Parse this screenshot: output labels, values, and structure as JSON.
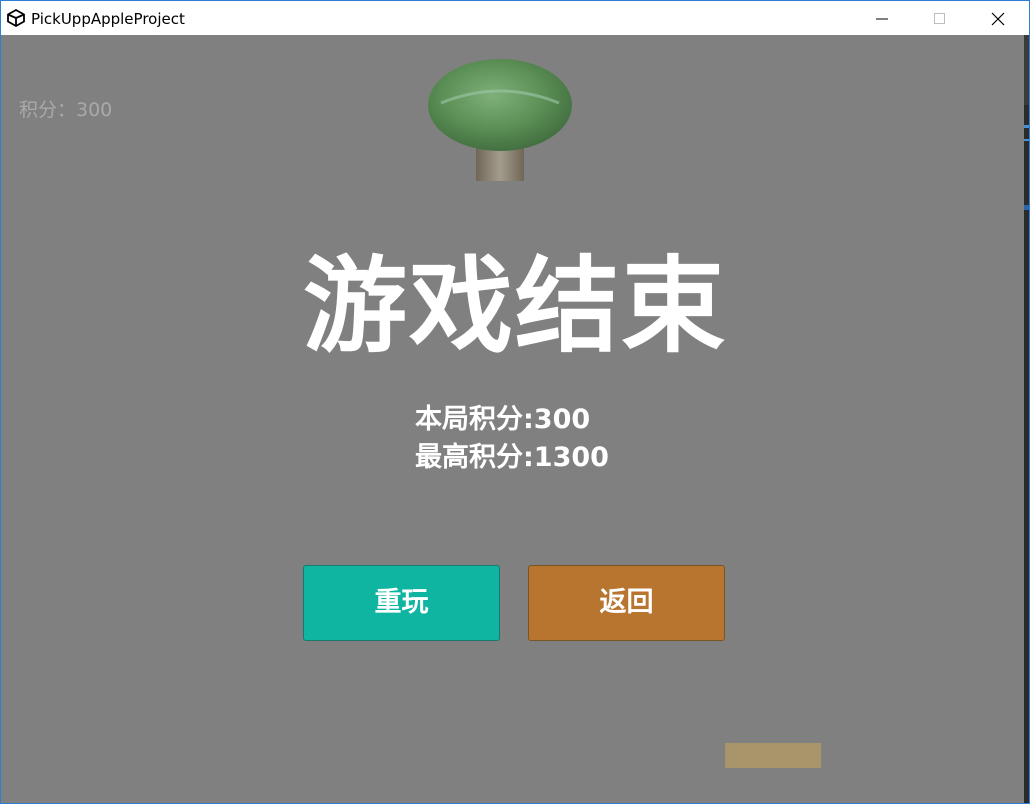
{
  "window": {
    "title": "PickUppAppleProject"
  },
  "hud": {
    "score_text": "积分：300"
  },
  "game_over": {
    "title": "游戏结束",
    "current_score_line": "本局积分:300",
    "high_score_line": "最高积分:1300"
  },
  "buttons": {
    "replay_label": "重玩",
    "back_label": "返回"
  },
  "colors": {
    "background": "#808080",
    "replay_button": "#0fb5a0",
    "back_button": "#b8752f",
    "basket": "#a8956a"
  },
  "icons": {
    "app": "unity-icon",
    "minimize": "minimize-icon",
    "maximize": "maximize-icon",
    "close": "close-icon"
  }
}
